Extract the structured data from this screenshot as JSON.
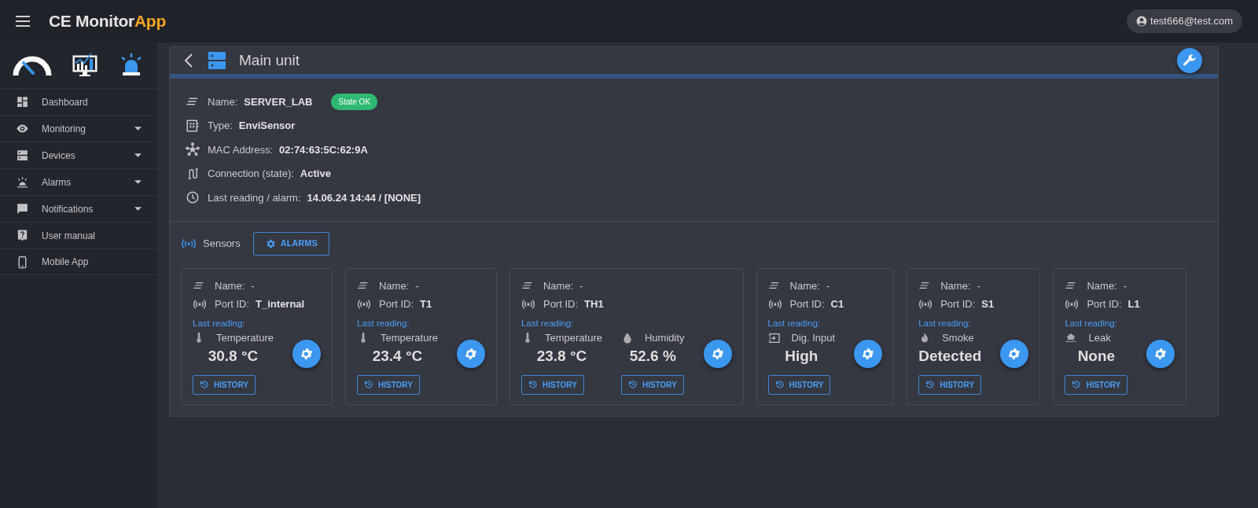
{
  "app": {
    "title_main": "CE Monitor",
    "title_accent": "App",
    "user": "test666@test.com"
  },
  "sidebar": {
    "items": [
      {
        "kind": "dashboard",
        "label": "Dashboard",
        "has_submenu": false
      },
      {
        "kind": "eye",
        "label": "Monitoring",
        "has_submenu": true
      },
      {
        "kind": "devices",
        "label": "Devices",
        "has_submenu": true
      },
      {
        "kind": "alarm",
        "label": "Alarms",
        "has_submenu": true
      },
      {
        "kind": "chat",
        "label": "Notifications",
        "has_submenu": true
      },
      {
        "kind": "help",
        "label": "User manual",
        "has_submenu": false
      },
      {
        "kind": "phone",
        "label": "Mobile App",
        "has_submenu": false
      }
    ]
  },
  "device": {
    "title": "Main unit",
    "fields": [
      {
        "kind": "name",
        "label": "Name:",
        "value": "SERVER_LAB",
        "badge": "State OK"
      },
      {
        "kind": "type",
        "label": "Type:",
        "value": "EnviSensor"
      },
      {
        "kind": "mac",
        "label": "MAC Address:",
        "value": "02:74:63:5C:62:9A"
      },
      {
        "kind": "connection",
        "label": "Connection (state):",
        "value": "Active"
      },
      {
        "kind": "clock",
        "label": "Last reading / alarm:",
        "value": "14.06.24 14:44 / [NONE]"
      }
    ],
    "sensors_label": "Sensors",
    "alarms_button": "ALARMS",
    "sensors": [
      {
        "name_label": "Name:",
        "name": "-",
        "port_label": "Port ID:",
        "port": "T_internal",
        "last_reading_label": "Last reading:",
        "readings": [
          {
            "kind": "temperature",
            "label": "Temperature",
            "value": "30.8 °C",
            "history": "HISTORY"
          }
        ]
      },
      {
        "name_label": "Name:",
        "name": "-",
        "port_label": "Port ID:",
        "port": "T1",
        "last_reading_label": "Last reading:",
        "readings": [
          {
            "kind": "temperature",
            "label": "Temperature",
            "value": "23.4 °C",
            "history": "HISTORY"
          }
        ]
      },
      {
        "name_label": "Name:",
        "name": "-",
        "port_label": "Port ID:",
        "port": "TH1",
        "last_reading_label": "Last reading:",
        "readings": [
          {
            "kind": "temperature",
            "label": "Temperature",
            "value": "23.8 °C",
            "history": "HISTORY"
          },
          {
            "kind": "humidity",
            "label": "Humidity",
            "value": "52.6 %",
            "history": "HISTORY"
          }
        ]
      },
      {
        "name_label": "Name:",
        "name": "-",
        "port_label": "Port ID:",
        "port": "C1",
        "last_reading_label": "Last reading:",
        "readings": [
          {
            "kind": "digital",
            "label": "Dig. Input",
            "value": "High",
            "history": "HISTORY"
          }
        ]
      },
      {
        "name_label": "Name:",
        "name": "-",
        "port_label": "Port ID:",
        "port": "S1",
        "last_reading_label": "Last reading:",
        "readings": [
          {
            "kind": "smoke",
            "label": "Smoke",
            "value": "Detected",
            "history": "HISTORY"
          }
        ]
      },
      {
        "name_label": "Name:",
        "name": "-",
        "port_label": "Port ID:",
        "port": "L1",
        "last_reading_label": "Last reading:",
        "readings": [
          {
            "kind": "leak",
            "label": "Leak",
            "value": "None",
            "history": "HISTORY"
          }
        ]
      }
    ]
  }
}
